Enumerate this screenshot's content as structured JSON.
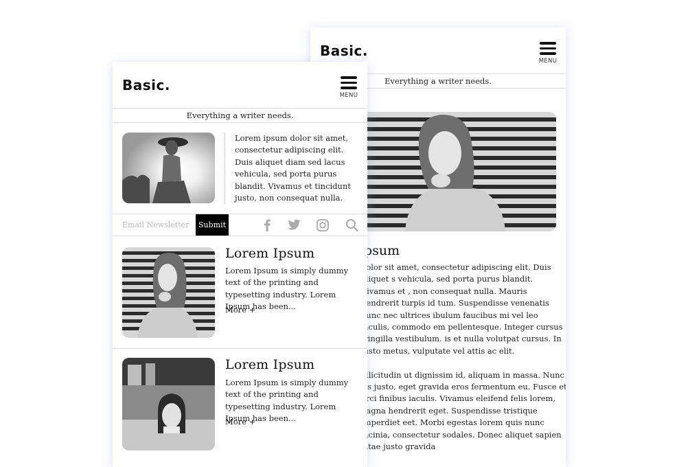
{
  "back_phone": {
    "logo": "Basic.",
    "menu_label": "MENU",
    "tagline": "Everything a writer needs.",
    "article_title": "psum",
    "paragraph1": "dolor sit amet, consectetur adipiscing elit. Duis aliquet s vehicula, sed porta purus blandit. Vivamus et , non consequat nulla. Mauris hendrerit turpis id tum. Suspendisse venenatis nunc nec ultrices ibulum faucibus mi vel leo iaculis, commodo em pellentesque. Integer cursus fringilla vestibulum. is et nulla volutpat cursus. In justo metus, vulputate vel attis ac elit.",
    "paragraph2": "ollicitudin ut dignissim id, aliquam in massa. Nunc ris justo, eget gravida eros fermentum eu. Fusce et orci finibus iaculis. Vivamus eleifend felis lorem, nagna hendrerit eget. Suspendisse tristique imperdiet eet. Morbi egestas lorem quis nunc lacinia, consectetur sodales. Donec aliquet sapien vitae justo gravida"
  },
  "front_phone": {
    "logo": "Basic.",
    "menu_label": "MENU",
    "tagline": "Everything a writer needs.",
    "intro": "Lorem ipsum dolor sit amet, consectetur adipiscing elit. Duis aliquet diam sed lacus vehicula, sed porta purus blandit. Vivamus et tincidunt justo, non consequat nulla.",
    "newsletter": {
      "placeholder": "Email Newsletter",
      "submit_label": "Submit"
    },
    "social_icons": [
      "facebook-icon",
      "twitter-icon",
      "instagram-icon",
      "search-icon"
    ],
    "articles": [
      {
        "title": "Lorem Ipsum",
        "excerpt": "Lorem Ipsum is simply dummy text of the printing and typesetting industry. Lorem Ipsum has been...",
        "more": "More +"
      },
      {
        "title": "Lorem Ipsum",
        "excerpt": "Lorem Ipsum is simply dummy text of the printing and typesetting industry. Lorem Ipsum has been...",
        "more": "More +"
      }
    ]
  }
}
